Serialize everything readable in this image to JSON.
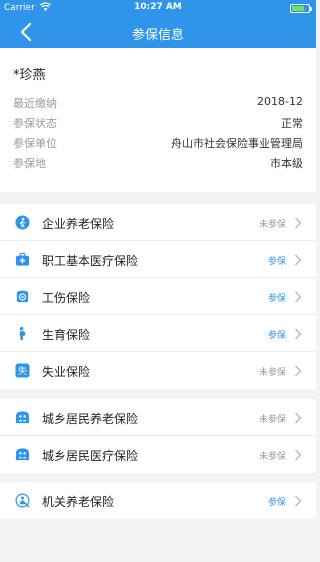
{
  "status_bar": {
    "carrier": "Carrier",
    "time": "10:27 AM",
    "battery_level": 0.75
  },
  "nav": {
    "title": "参保信息"
  },
  "person": {
    "name": "*珍燕",
    "fields": [
      {
        "label": "最近缴纳",
        "value": "2018-12"
      },
      {
        "label": "参保状态",
        "value": "正常"
      },
      {
        "label": "参保单位",
        "value": "舟山市社会保险事业管理局"
      },
      {
        "label": "参保地",
        "value": "市本级"
      }
    ]
  },
  "groups": [
    {
      "items": [
        {
          "icon": "pension-person-icon",
          "label": "企业养老保险",
          "status": "未参保",
          "enrolled": false
        },
        {
          "icon": "medical-kit-icon",
          "label": "职工基本医疗保险",
          "status": "参保",
          "enrolled": true
        },
        {
          "icon": "injury-badge-icon",
          "label": "工伤保险",
          "status": "参保",
          "enrolled": true
        },
        {
          "icon": "maternity-icon",
          "label": "生育保险",
          "status": "参保",
          "enrolled": true
        },
        {
          "icon": "unemployment-icon",
          "label": "失业保险",
          "status": "未参保",
          "enrolled": false
        }
      ]
    },
    {
      "items": [
        {
          "icon": "resident-pension-icon",
          "label": "城乡居民养老保险",
          "status": "未参保",
          "enrolled": false
        },
        {
          "icon": "resident-medical-icon",
          "label": "城乡居民医疗保险",
          "status": "未参保",
          "enrolled": false
        }
      ]
    },
    {
      "items": [
        {
          "icon": "institution-pension-icon",
          "label": "机关养老保险",
          "status": "参保",
          "enrolled": true
        }
      ]
    }
  ],
  "unemployment_icon_glyph": "失",
  "colors": {
    "primary": "#2f95ea",
    "status_gray": "#999999",
    "background": "#f2f3f5"
  }
}
